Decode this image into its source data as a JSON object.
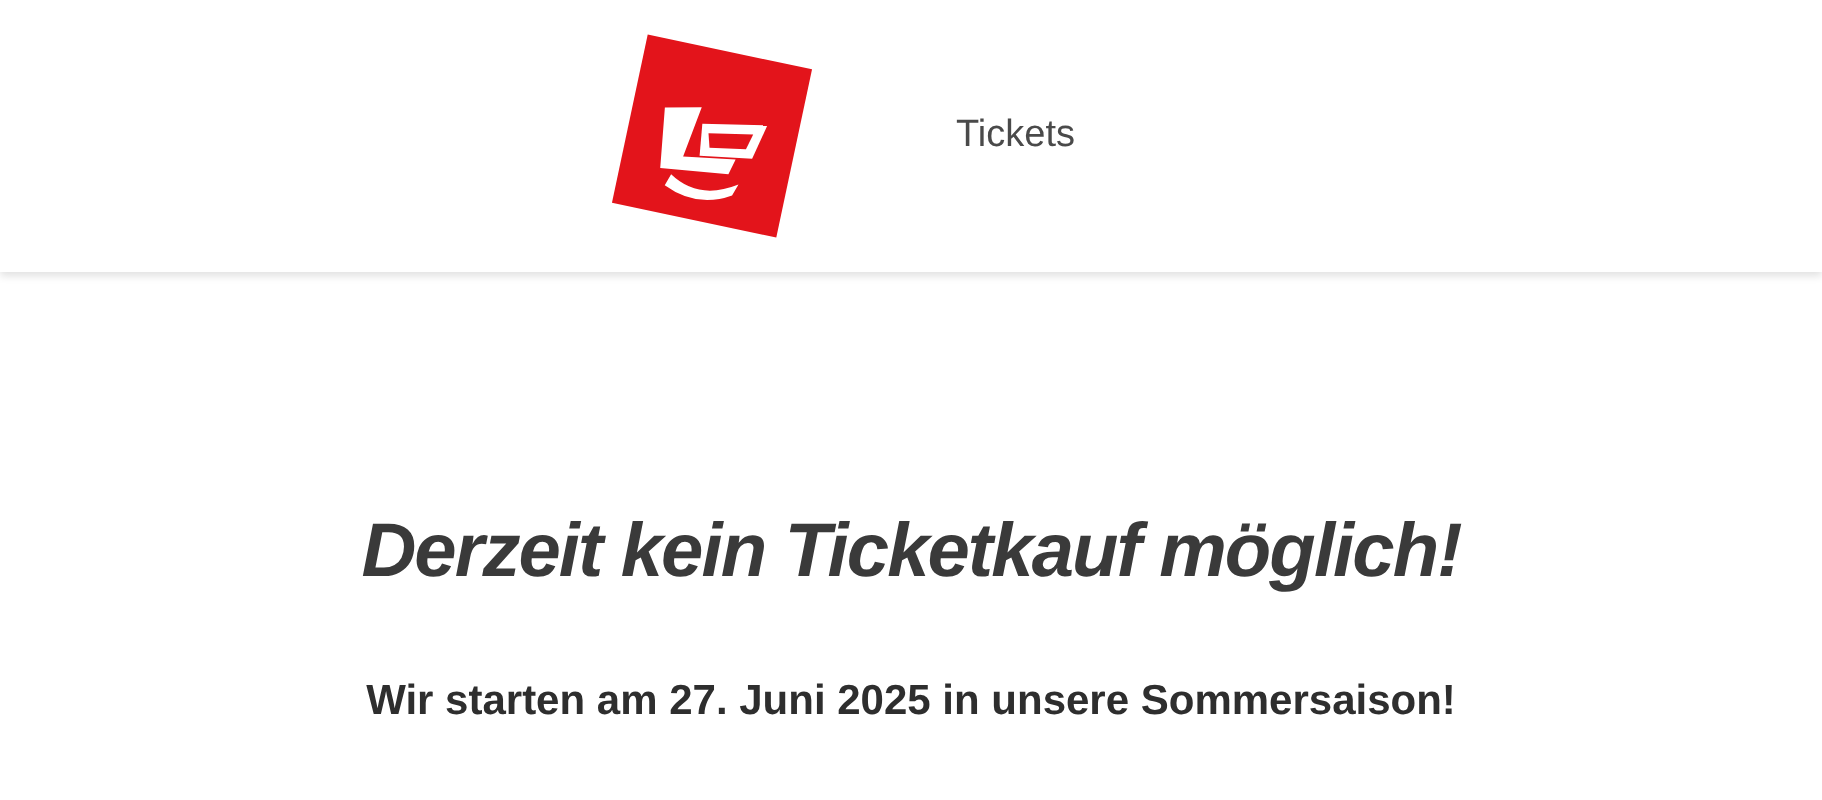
{
  "header": {
    "nav": [
      {
        "label": "Tickets"
      }
    ]
  },
  "notice": {
    "title": "Derzeit kein Ticketkauf möglich!",
    "subtitle": "Wir starten am 27. Juni 2025 in unsere Sommersaison!"
  }
}
